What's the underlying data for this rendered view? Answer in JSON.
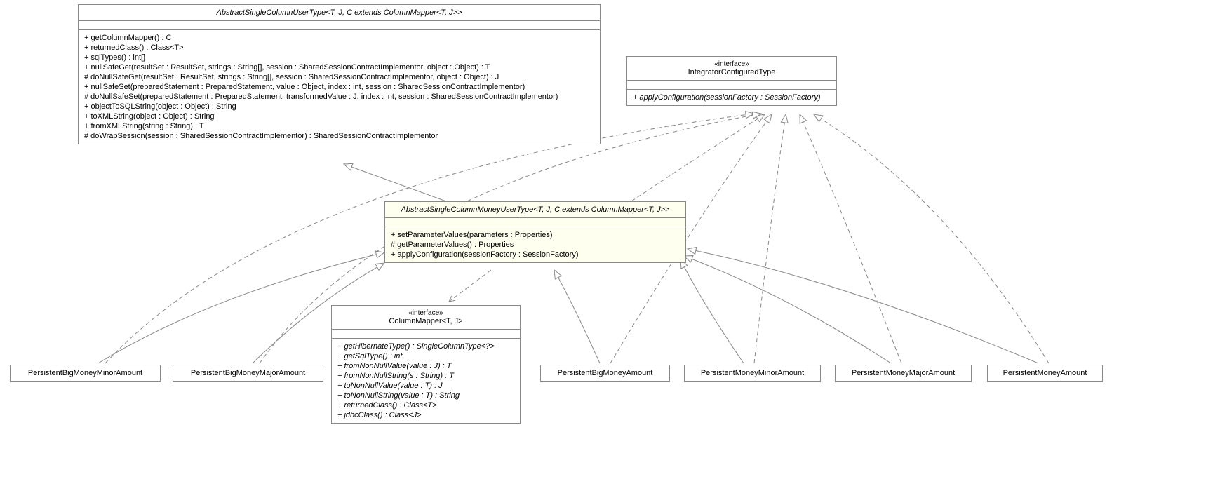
{
  "classes": {
    "abstractSingleColumnUserType": {
      "name": "AbstractSingleColumnUserType<T, J, C extends ColumnMapper<T, J>>",
      "methods": [
        "+ getColumnMapper() : C",
        "+ returnedClass() : Class<T>",
        "+ sqlTypes() : int[]",
        "+ nullSafeGet(resultSet : ResultSet, strings : String[], session : SharedSessionContractImplementor, object : Object) : T",
        "# doNullSafeGet(resultSet : ResultSet, strings : String[], session : SharedSessionContractImplementor, object : Object) : J",
        "+ nullSafeSet(preparedStatement : PreparedStatement, value : Object, index : int, session : SharedSessionContractImplementor)",
        "# doNullSafeSet(preparedStatement : PreparedStatement, transformedValue : J, index : int, session : SharedSessionContractImplementor)",
        "+ objectToSQLString(object : Object) : String",
        "+ toXMLString(object : Object) : String",
        "+ fromXMLString(string : String) : T",
        "# doWrapSession(session : SharedSessionContractImplementor) : SharedSessionContractImplementor"
      ]
    },
    "integratorConfiguredType": {
      "stereotype": "«interface»",
      "name": "IntegratorConfiguredType",
      "methods": [
        "+ applyConfiguration(sessionFactory : SessionFactory)"
      ]
    },
    "abstractSingleColumnMoneyUserType": {
      "name": "AbstractSingleColumnMoneyUserType<T, J, C extends ColumnMapper<T, J>>",
      "methods": [
        "+ setParameterValues(parameters : Properties)",
        "# getParameterValues() : Properties",
        "+ applyConfiguration(sessionFactory : SessionFactory)"
      ]
    },
    "columnMapper": {
      "stereotype": "«interface»",
      "name": "ColumnMapper<T, J>",
      "methods": [
        "+ getHibernateType() : SingleColumnType<?>",
        "+ getSqlType() : int",
        "+ fromNonNullValue(value : J) : T",
        "+ fromNonNullString(s : String) : T",
        "+ toNonNullValue(value : T) : J",
        "+ toNonNullString(value : T) : String",
        "+ returnedClass() : Class<T>",
        "+ jdbcClass() : Class<J>"
      ]
    },
    "persistentBigMoneyMinorAmount": {
      "name": "PersistentBigMoneyMinorAmount"
    },
    "persistentBigMoneyMajorAmount": {
      "name": "PersistentBigMoneyMajorAmount"
    },
    "persistentBigMoneyAmount": {
      "name": "PersistentBigMoneyAmount"
    },
    "persistentMoneyMinorAmount": {
      "name": "PersistentMoneyMinorAmount"
    },
    "persistentMoneyMajorAmount": {
      "name": "PersistentMoneyMajorAmount"
    },
    "persistentMoneyAmount": {
      "name": "PersistentMoneyAmount"
    }
  },
  "chart_data": {
    "type": "uml-class-diagram",
    "relationships": [
      {
        "from": "AbstractSingleColumnMoneyUserType",
        "to": "AbstractSingleColumnUserType",
        "type": "generalization"
      },
      {
        "from": "AbstractSingleColumnMoneyUserType",
        "to": "IntegratorConfiguredType",
        "type": "realization"
      },
      {
        "from": "AbstractSingleColumnMoneyUserType",
        "to": "ColumnMapper",
        "type": "dependency"
      },
      {
        "from": "PersistentBigMoneyMinorAmount",
        "to": "AbstractSingleColumnMoneyUserType",
        "type": "generalization"
      },
      {
        "from": "PersistentBigMoneyMinorAmount",
        "to": "IntegratorConfiguredType",
        "type": "realization"
      },
      {
        "from": "PersistentBigMoneyMajorAmount",
        "to": "AbstractSingleColumnMoneyUserType",
        "type": "generalization"
      },
      {
        "from": "PersistentBigMoneyMajorAmount",
        "to": "IntegratorConfiguredType",
        "type": "realization"
      },
      {
        "from": "PersistentBigMoneyAmount",
        "to": "AbstractSingleColumnMoneyUserType",
        "type": "generalization"
      },
      {
        "from": "PersistentBigMoneyAmount",
        "to": "IntegratorConfiguredType",
        "type": "realization"
      },
      {
        "from": "PersistentMoneyMinorAmount",
        "to": "AbstractSingleColumnMoneyUserType",
        "type": "generalization"
      },
      {
        "from": "PersistentMoneyMinorAmount",
        "to": "IntegratorConfiguredType",
        "type": "realization"
      },
      {
        "from": "PersistentMoneyMajorAmount",
        "to": "AbstractSingleColumnMoneyUserType",
        "type": "generalization"
      },
      {
        "from": "PersistentMoneyMajorAmount",
        "to": "IntegratorConfiguredType",
        "type": "realization"
      },
      {
        "from": "PersistentMoneyAmount",
        "to": "AbstractSingleColumnMoneyUserType",
        "type": "generalization"
      },
      {
        "from": "PersistentMoneyAmount",
        "to": "IntegratorConfiguredType",
        "type": "realization"
      }
    ]
  }
}
